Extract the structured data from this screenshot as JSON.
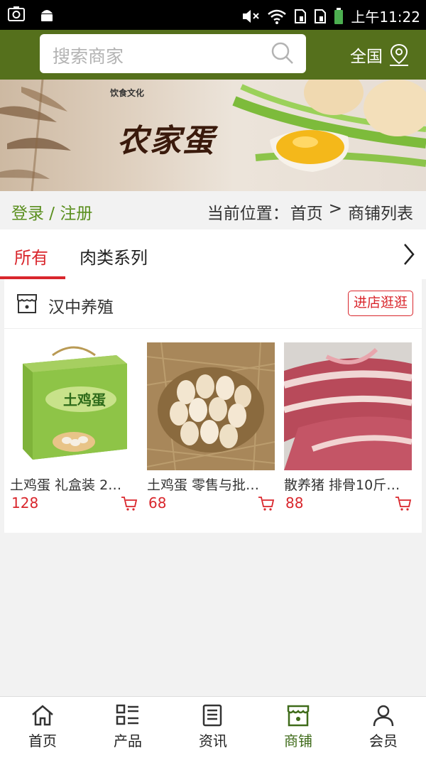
{
  "status_bar": {
    "time": "上午11:22"
  },
  "header": {
    "search_placeholder": "搜索商家",
    "region_label": "全国"
  },
  "banner": {
    "headline": "农家蛋",
    "tagline": "饮食文化"
  },
  "breadcrumb": {
    "login_label": "登录 / 注册",
    "prefix": "当前位置：",
    "home": "首页",
    "separator": ">",
    "current": "商铺列表"
  },
  "tabs": [
    {
      "label": "所有",
      "active": true
    },
    {
      "label": "肉类系列",
      "active": false
    }
  ],
  "shop": {
    "name": "汉中养殖",
    "enter_label": "进店逛逛",
    "products": [
      {
        "title": "土鸡蛋 礼盒装 2…",
        "price": "128",
        "image": "egg-gift-box"
      },
      {
        "title": "土鸡蛋 零售与批…",
        "price": "68",
        "image": "eggs-in-nest"
      },
      {
        "title": "散养猪 排骨10斤…",
        "price": "88",
        "image": "pork-ribs"
      }
    ]
  },
  "bottom_nav": [
    {
      "label": "首页",
      "icon": "home-icon",
      "active": false
    },
    {
      "label": "产品",
      "icon": "grid-list-icon",
      "active": false
    },
    {
      "label": "资讯",
      "icon": "news-icon",
      "active": false
    },
    {
      "label": "商铺",
      "icon": "store-icon",
      "active": true
    },
    {
      "label": "会员",
      "icon": "user-icon",
      "active": false
    }
  ],
  "colors": {
    "header_green": "#55701c",
    "accent_red": "#d9262c",
    "login_green": "#5a8f1e"
  }
}
